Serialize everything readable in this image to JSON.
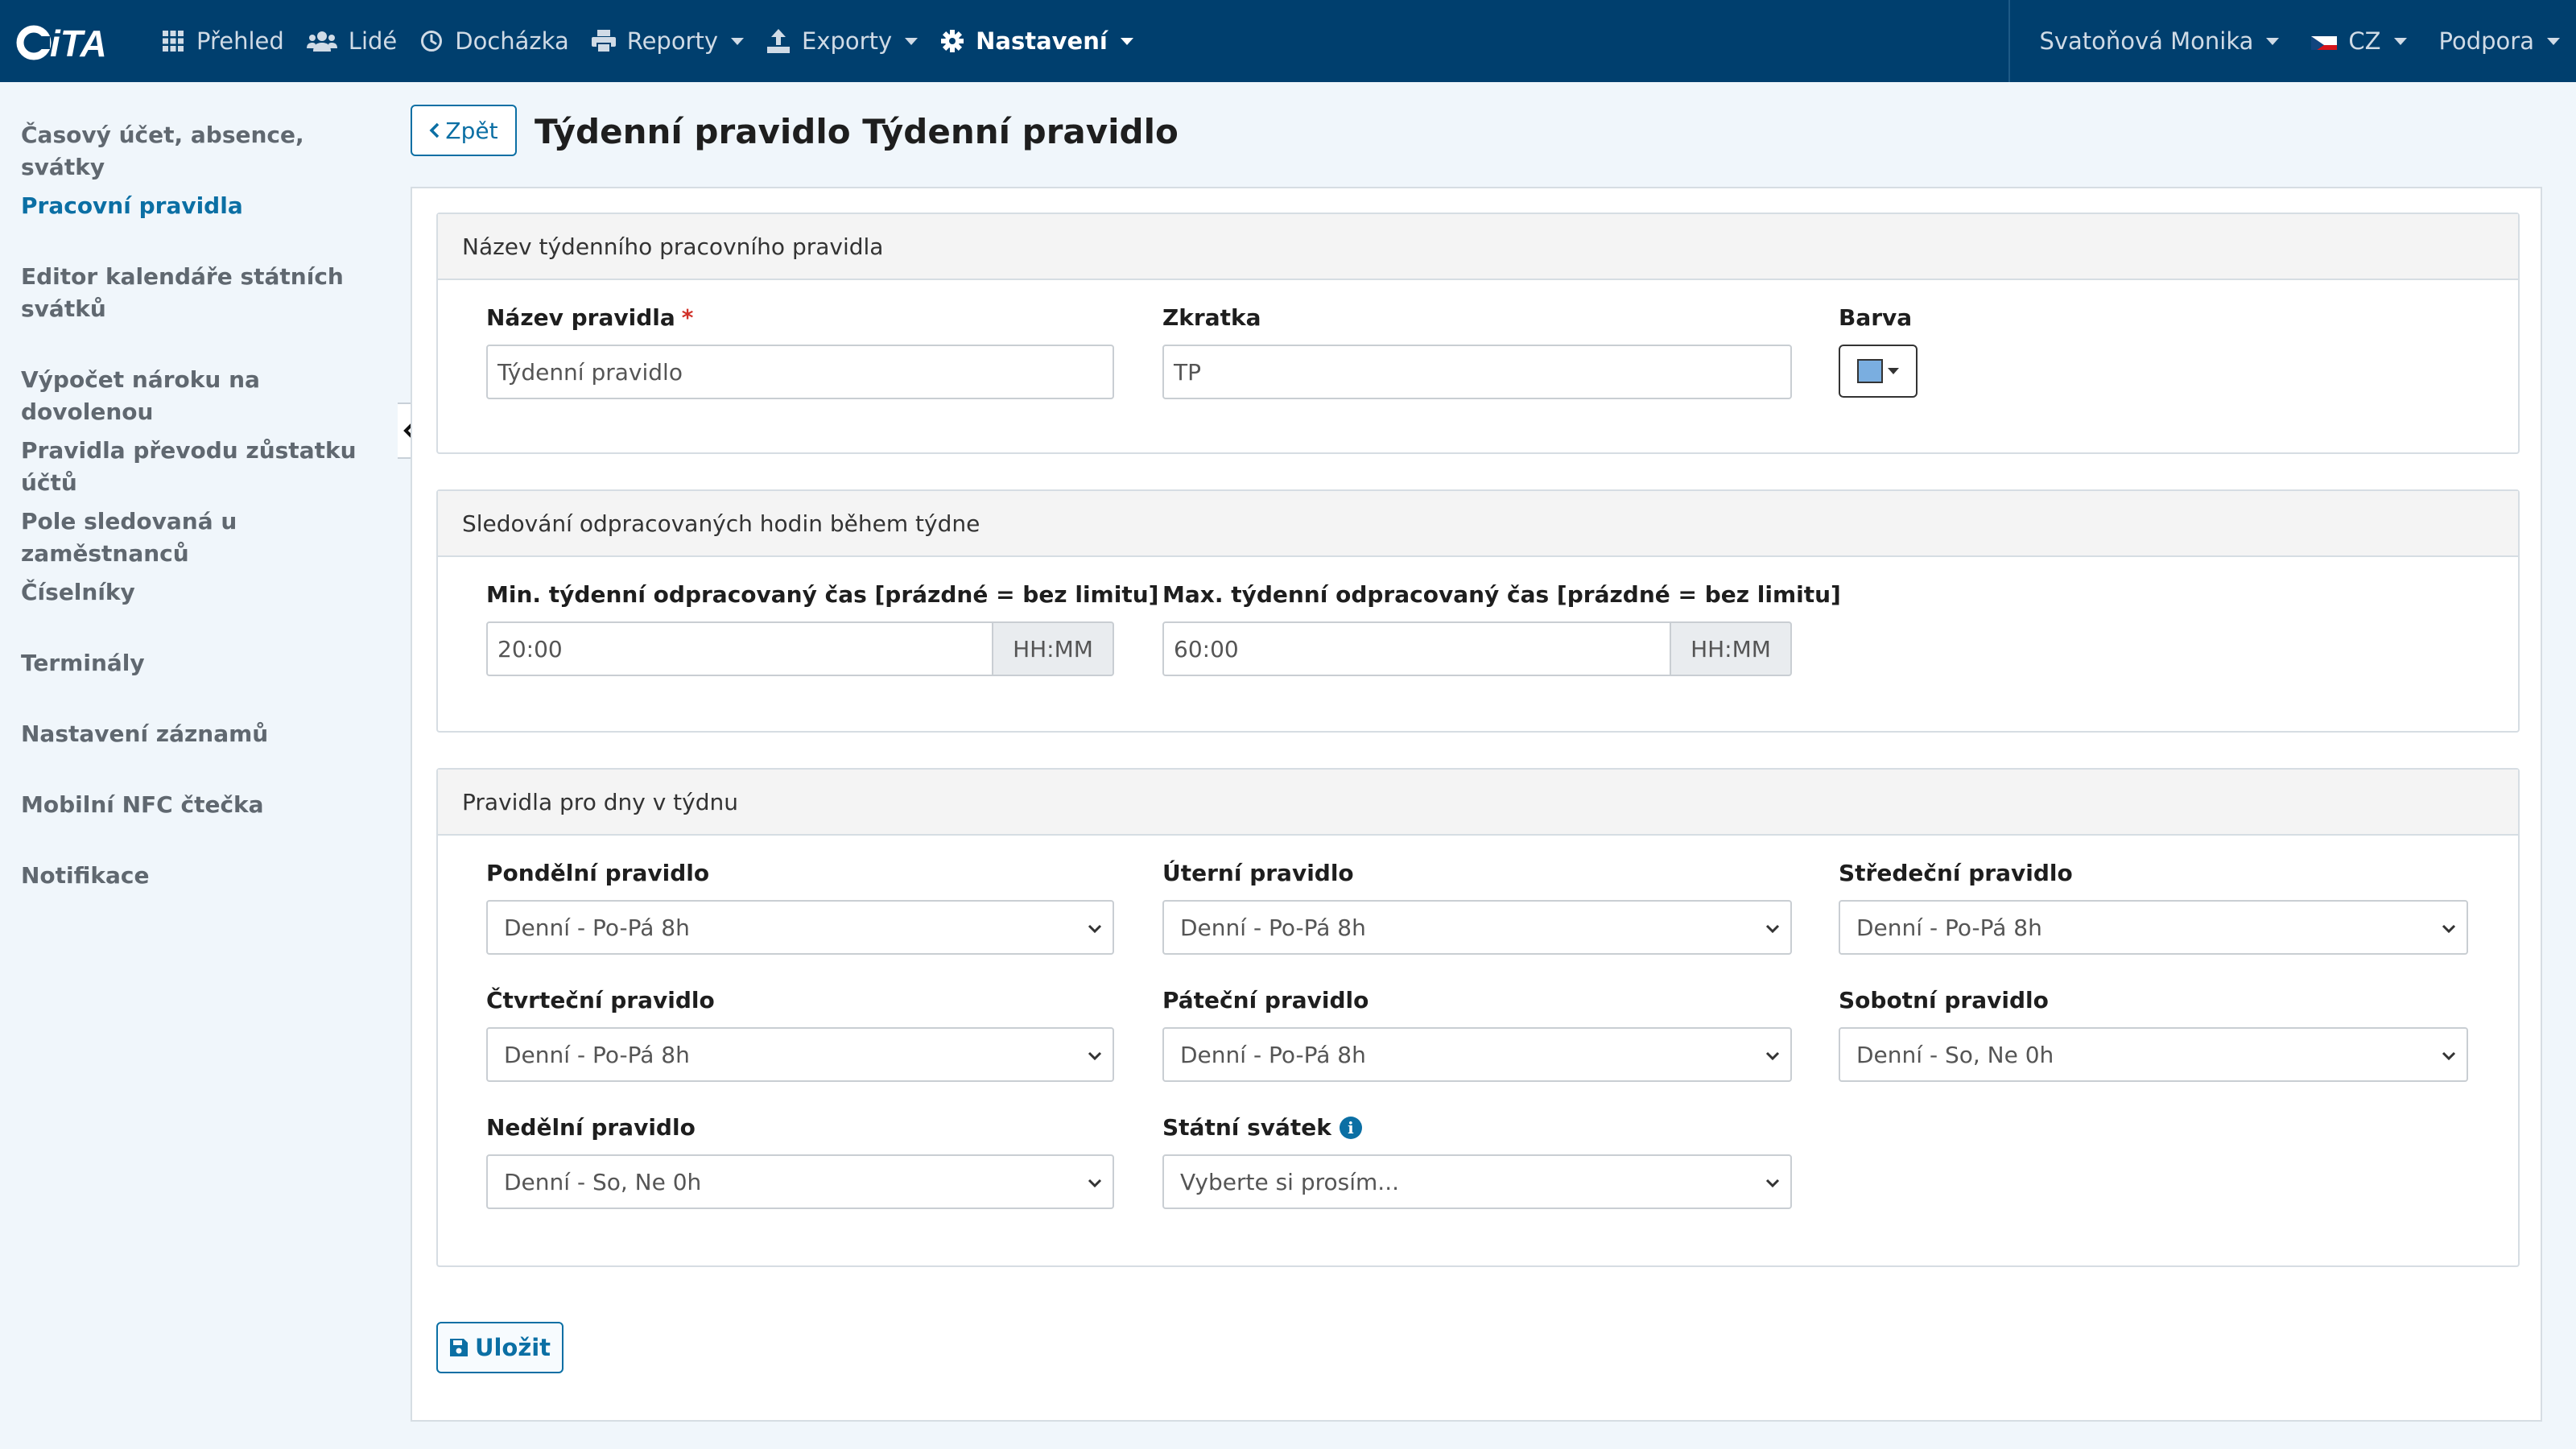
{
  "nav": {
    "brand": "iTA",
    "items": [
      {
        "label": "Přehled",
        "icon": "grid-icon"
      },
      {
        "label": "Lidé",
        "icon": "users-icon"
      },
      {
        "label": "Docházka",
        "icon": "clock-icon"
      },
      {
        "label": "Reporty",
        "icon": "printer-icon"
      },
      {
        "label": "Exporty",
        "icon": "export-icon"
      },
      {
        "label": "Nastavení",
        "icon": "gear-icon"
      }
    ],
    "user": "Svatoňová Monika",
    "lang": "CZ",
    "support": "Podpora"
  },
  "sidebar": {
    "items": [
      {
        "label": "Časový účet, absence, svátky"
      },
      {
        "label": "Pracovní pravidla"
      },
      {
        "label": "Editor kalendáře státních svátků"
      },
      {
        "label": "Výpočet nároku na dovolenou"
      },
      {
        "label": "Pravidla převodu zůstatku účtů"
      },
      {
        "label": "Pole sledovaná u zaměstnanců"
      },
      {
        "label": "Číselníky"
      },
      {
        "label": "Terminály"
      },
      {
        "label": "Nastavení záznamů"
      },
      {
        "label": "Mobilní NFC čtečka"
      },
      {
        "label": "Notifikace"
      }
    ],
    "active_index": 1
  },
  "page": {
    "back_label": "Zpět",
    "title": "Týdenní pravidlo Týdenní pravidlo",
    "save_label": "Uložit"
  },
  "card_name": {
    "header": "Název týdenního pracovního pravidla",
    "name_label": "Název pravidla",
    "required_mark": "*",
    "name_value": "Týdenní pravidlo",
    "abbr_label": "Zkratka",
    "abbr_value": "TP",
    "color_label": "Barva",
    "color_value": "#7aaee0"
  },
  "card_hours": {
    "header": "Sledování odpracovaných hodin během týdne",
    "min_label": "Min. týdenní odpracovaný čas [prázdné = bez limitu]",
    "min_value": "20:00",
    "max_label": "Max. týdenní odpracovaný čas [prázdné = bez limitu]",
    "max_value": "60:00",
    "unit": "HH:MM"
  },
  "card_days": {
    "header": "Pravidla pro dny v týdnu",
    "fields": [
      {
        "label": "Pondělní pravidlo",
        "value": "Denní - Po-Pá 8h"
      },
      {
        "label": "Úterní pravidlo",
        "value": "Denní - Po-Pá 8h"
      },
      {
        "label": "Středeční pravidlo",
        "value": "Denní - Po-Pá 8h"
      },
      {
        "label": "Čtvrteční pravidlo",
        "value": "Denní - Po-Pá 8h"
      },
      {
        "label": "Páteční pravidlo",
        "value": "Denní - Po-Pá 8h"
      },
      {
        "label": "Sobotní pravidlo",
        "value": "Denní - So, Ne 0h"
      },
      {
        "label": "Nedělní pravidlo",
        "value": "Denní - So, Ne 0h"
      },
      {
        "label": "Státní svátek",
        "value": "Vyberte si prosím..."
      }
    ]
  },
  "colors": {
    "navbar": "#003f6e",
    "accent": "#0b6fa4",
    "required": "#d1322a"
  }
}
